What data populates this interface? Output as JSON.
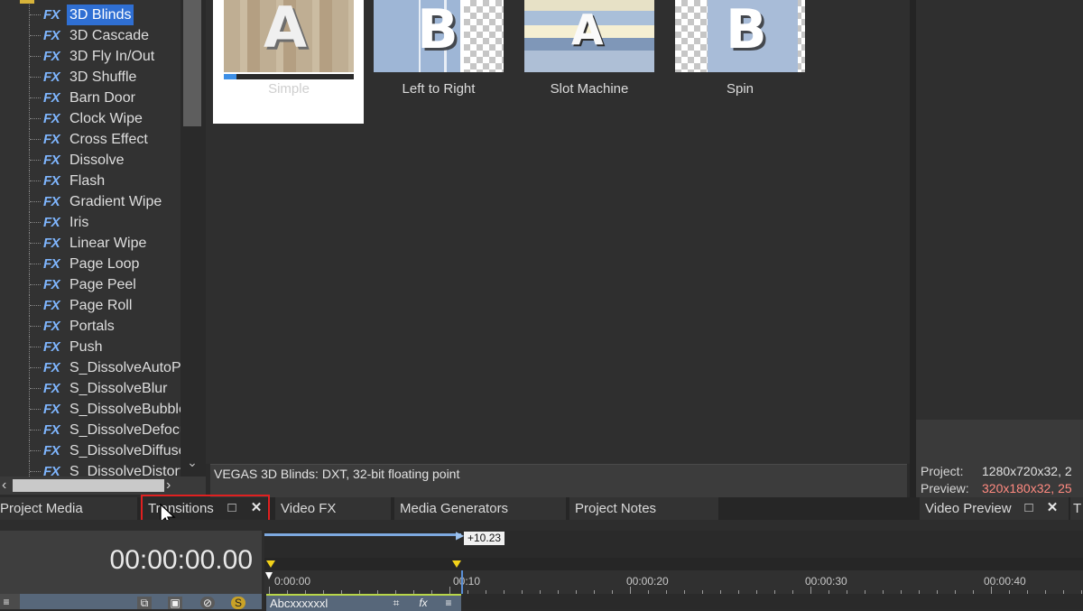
{
  "tree": {
    "items": [
      {
        "label": "3D Blinds",
        "selected": true
      },
      {
        "label": "3D Cascade"
      },
      {
        "label": "3D Fly In/Out"
      },
      {
        "label": "3D Shuffle"
      },
      {
        "label": "Barn Door"
      },
      {
        "label": "Clock Wipe"
      },
      {
        "label": "Cross Effect"
      },
      {
        "label": "Dissolve"
      },
      {
        "label": "Flash"
      },
      {
        "label": "Gradient Wipe"
      },
      {
        "label": "Iris"
      },
      {
        "label": "Linear Wipe"
      },
      {
        "label": "Page Loop"
      },
      {
        "label": "Page Peel"
      },
      {
        "label": "Page Roll"
      },
      {
        "label": "Portals"
      },
      {
        "label": "Push"
      },
      {
        "label": "S_DissolveAutoPa"
      },
      {
        "label": "S_DissolveBlur"
      },
      {
        "label": "S_DissolveBubble"
      },
      {
        "label": "S_DissolveDefocu"
      },
      {
        "label": "S_DissolveDiffuse"
      },
      {
        "label": "S_DissolveDistort"
      }
    ],
    "fx_badge": "FX"
  },
  "presets": [
    {
      "label": "Simple",
      "letter": "A",
      "selected": true,
      "preview_progress": 0.1
    },
    {
      "label": "Left to Right",
      "letter": "B"
    },
    {
      "label": "Slot Machine",
      "letter": "A"
    },
    {
      "label": "Spin",
      "letter": "B"
    }
  ],
  "description": "VEGAS 3D Blinds: DXT, 32-bit floating point",
  "preview_info": {
    "project_label": "Project:",
    "project_value": "1280x720x32, 2",
    "preview_label": "Preview:",
    "preview_value": "320x180x32, 25"
  },
  "tabs": {
    "project_media": "Project Media",
    "transitions": "Transitions",
    "video_fx": "Video FX",
    "media_generators": "Media Generators",
    "project_notes": "Project Notes",
    "video_preview": "Video Preview",
    "truncated_right": "T",
    "maximize_glyph": "□",
    "close_glyph": "✕"
  },
  "timeline": {
    "time_display": "00:00:00.00",
    "loop_length": "+10.23",
    "ruler_labels": [
      "0:00:00",
      "00:10",
      "00:00:20",
      "00:00:30",
      "00:00:40"
    ],
    "clip_name": "Abcxxxxxxl"
  },
  "colors": {
    "accent_selected": "#2f6fd3",
    "highlight_box": "#e02020",
    "loop_marker": "#f2d21a",
    "preview_value_text": "#ff8a80"
  }
}
